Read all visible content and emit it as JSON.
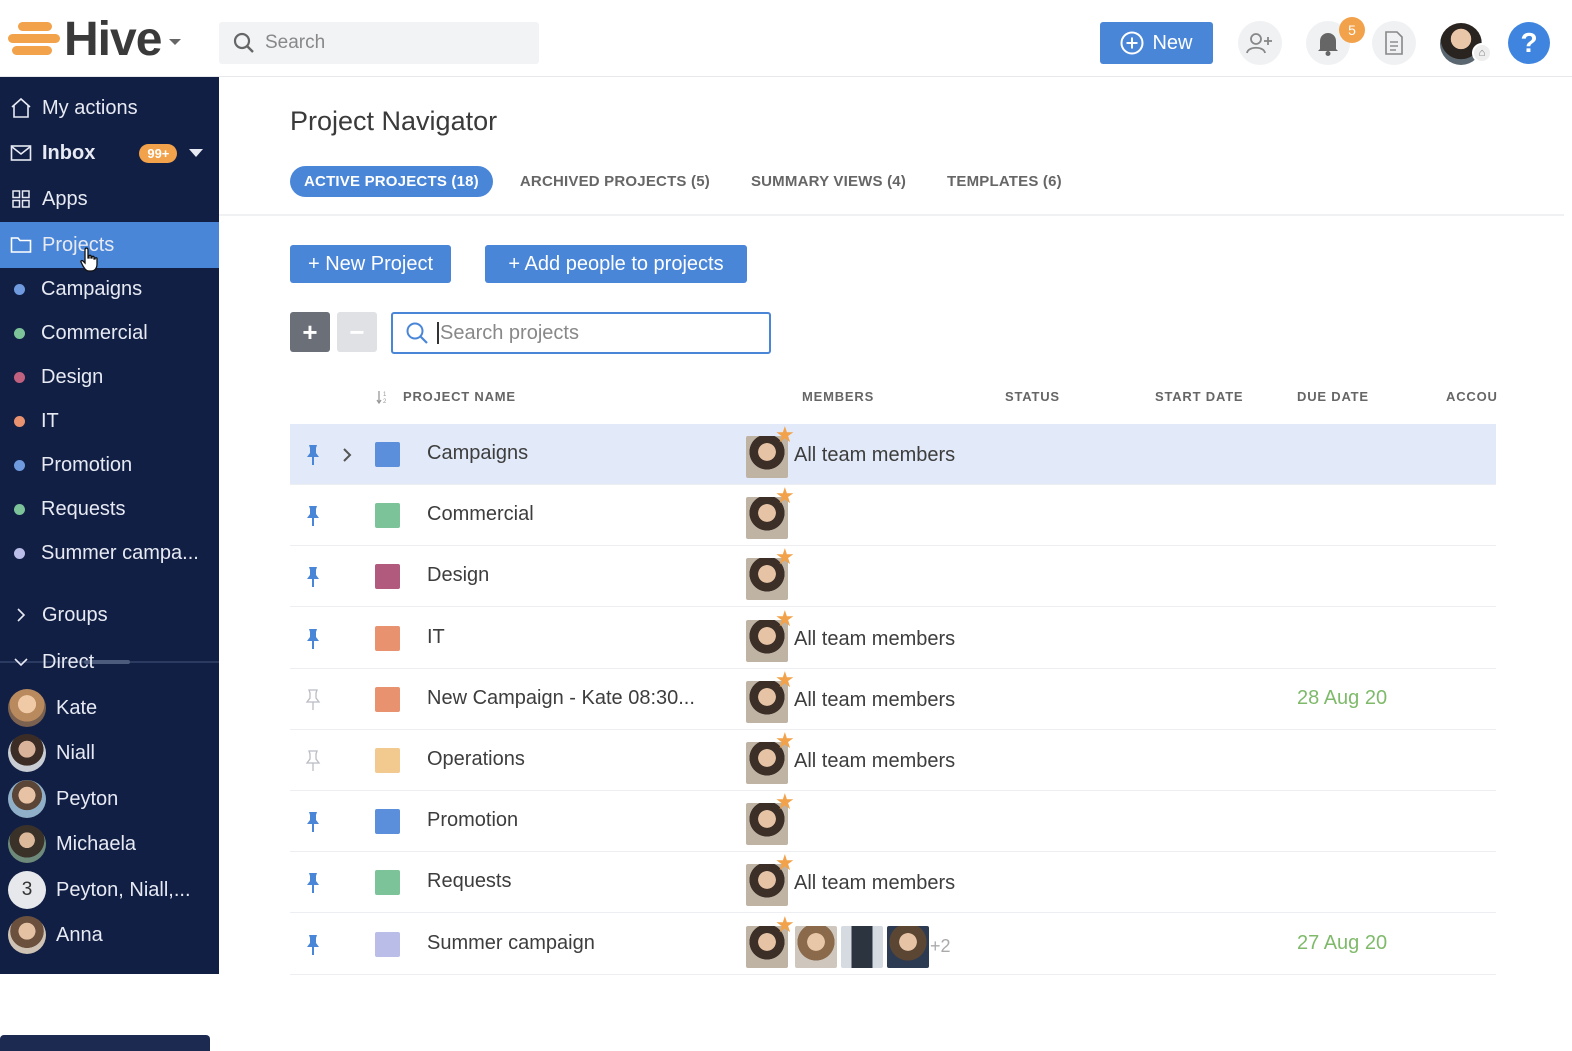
{
  "topbar": {
    "logo_text": "Hive",
    "search_placeholder": "Search",
    "new_button": "New",
    "notifications_count": "5",
    "help_label": "?"
  },
  "sidebar": {
    "nav": [
      {
        "label": "My actions",
        "icon": "home-icon"
      },
      {
        "label": "Inbox",
        "icon": "mail-icon",
        "badge": "99+"
      },
      {
        "label": "Apps",
        "icon": "grid-icon"
      },
      {
        "label": "Projects",
        "icon": "folder-icon",
        "active": true
      }
    ],
    "projects": [
      {
        "label": "Campaigns",
        "color": "#6f9ae0"
      },
      {
        "label": "Commercial",
        "color": "#7cc39a"
      },
      {
        "label": "Design",
        "color": "#c0617f"
      },
      {
        "label": "IT",
        "color": "#e89270"
      },
      {
        "label": "Promotion",
        "color": "#6f9ae0"
      },
      {
        "label": "Requests",
        "color": "#7cc39a"
      },
      {
        "label": "Summer campa...",
        "color": "#b9bde8"
      }
    ],
    "groups_label": "Groups",
    "direct_label": "Direct",
    "direct": [
      {
        "label": "Kate"
      },
      {
        "label": "Niall"
      },
      {
        "label": "Peyton"
      },
      {
        "label": "Michaela"
      },
      {
        "label": "Peyton, Niall,...",
        "count": "3"
      },
      {
        "label": "Anna"
      }
    ]
  },
  "main": {
    "title": "Project Navigator",
    "tabs": [
      {
        "label": "ACTIVE PROJECTS (18)",
        "active": true
      },
      {
        "label": "ARCHIVED PROJECTS (5)"
      },
      {
        "label": "SUMMARY VIEWS (4)"
      },
      {
        "label": "TEMPLATES (6)"
      }
    ],
    "new_project_button": "+ New Project",
    "add_people_button": "+ Add people to projects",
    "expand_button": "+",
    "collapse_button": "−",
    "search_placeholder": "Search projects",
    "columns": [
      "PROJECT NAME",
      "MEMBERS",
      "STATUS",
      "START DATE",
      "DUE DATE",
      "ACCOU"
    ],
    "rows": [
      {
        "name": "Campaigns",
        "color": "#5b8fdc",
        "pinned": true,
        "members": "All team members",
        "due": "",
        "selected": true
      },
      {
        "name": "Commercial",
        "color": "#7cc39a",
        "pinned": true,
        "members": "",
        "due": ""
      },
      {
        "name": "Design",
        "color": "#b25a7d",
        "pinned": true,
        "members": "",
        "due": ""
      },
      {
        "name": "IT",
        "color": "#e89270",
        "pinned": true,
        "members": "All team members",
        "due": ""
      },
      {
        "name": "New Campaign - Kate 08:30...",
        "color": "#e89270",
        "pinned": false,
        "members": "All team members",
        "due": "28 Aug 20"
      },
      {
        "name": "Operations",
        "color": "#f2c98e",
        "pinned": false,
        "members": "All team members",
        "due": ""
      },
      {
        "name": "Promotion",
        "color": "#5b8fdc",
        "pinned": true,
        "members": "",
        "due": ""
      },
      {
        "name": "Requests",
        "color": "#7cc39a",
        "pinned": true,
        "members": "All team members",
        "due": ""
      },
      {
        "name": "Summer campaign",
        "color": "#b9bde8",
        "pinned": true,
        "members": "",
        "due": "27 Aug 20",
        "extra_members": "+2"
      }
    ]
  }
}
